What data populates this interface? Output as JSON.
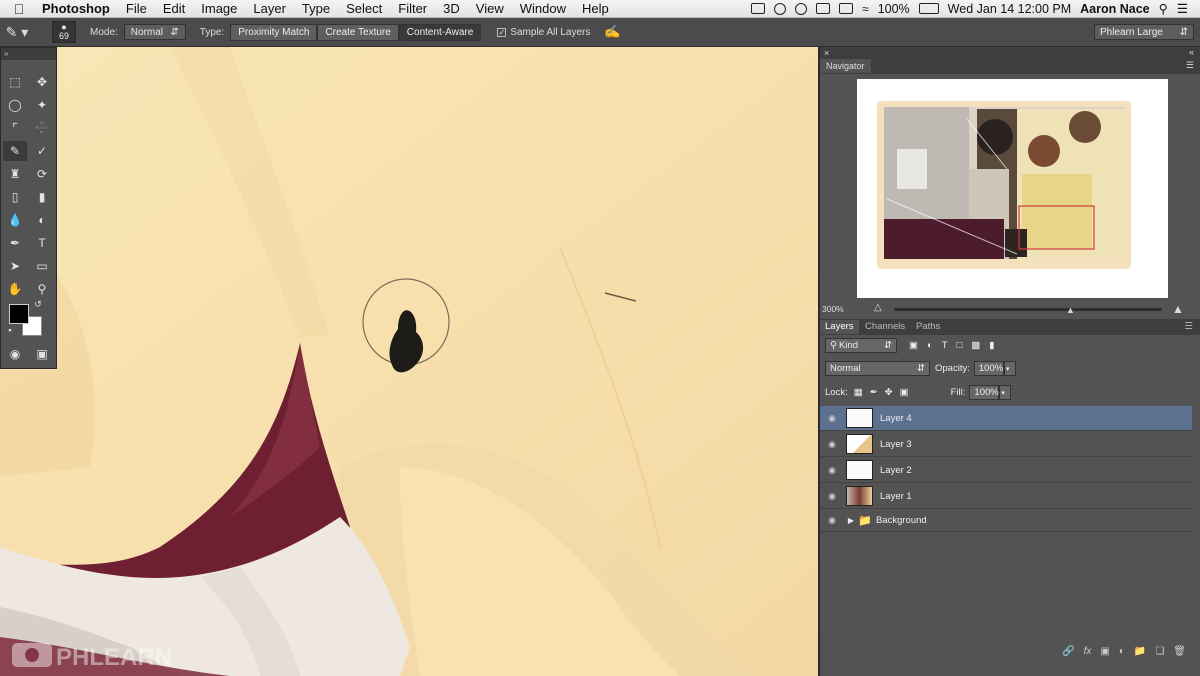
{
  "menubar": {
    "app_name": "Photoshop",
    "menus": [
      "File",
      "Edit",
      "Image",
      "Layer",
      "Type",
      "Select",
      "Filter",
      "3D",
      "View",
      "Window",
      "Help"
    ],
    "battery": "100%",
    "clock": "Wed Jan 14  12:00 PM",
    "user": "Aaron Nace"
  },
  "options": {
    "brush_size": "69",
    "mode_label": "Mode:",
    "mode_value": "Normal",
    "type_label": "Type:",
    "type_options": [
      "Proximity Match",
      "Create Texture",
      "Content-Aware"
    ],
    "type_selected": "Content-Aware",
    "sample_all": "Sample All Layers",
    "workspace": "Phlearn Large"
  },
  "navigator": {
    "title": "Navigator",
    "zoom": "300%"
  },
  "layers_panel": {
    "tabs": [
      "Layers",
      "Channels",
      "Paths"
    ],
    "filter_kind": "Kind",
    "blend_mode": "Normal",
    "opacity_label": "Opacity:",
    "opacity_value": "100%",
    "lock_label": "Lock:",
    "fill_label": "Fill:",
    "fill_value": "100%",
    "layers": [
      {
        "name": "Layer 4",
        "selected": true
      },
      {
        "name": "Layer 3",
        "selected": false
      },
      {
        "name": "Layer 2",
        "selected": false
      },
      {
        "name": "Layer 1",
        "selected": false
      },
      {
        "name": "Background",
        "selected": false
      }
    ]
  },
  "watermark": "PHLEARN",
  "colors": {
    "accent_selected_layer": "#5c708f",
    "panel_bg": "#535353",
    "canvas_bg": "#f7e4b4"
  }
}
